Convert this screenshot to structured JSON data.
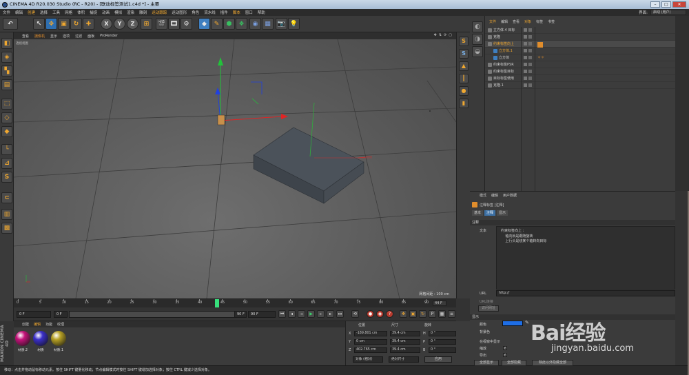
{
  "window": {
    "title": "CINEMA 4D R20.030 Studio (RC - R20) - [联动标签测试1.c4d *] - 主要",
    "min": "–",
    "max": "□",
    "close": "✕"
  },
  "menubar": {
    "items": [
      "文件",
      "编辑",
      "创建",
      "选择",
      "工具",
      "网格",
      "体积",
      "捕捉",
      "动画",
      "模拟",
      "渲染",
      "雕刻",
      "运动跟踪",
      "运动图形",
      "角色",
      "流水线",
      "插件",
      "脚本",
      "窗口",
      "帮助"
    ],
    "highlighted": [
      2,
      12,
      17
    ],
    "layout_label": "界面:",
    "layout_value": "启动 (用户)"
  },
  "toolbar": {
    "undo": "↶",
    "axes": [
      "X",
      "Y",
      "Z"
    ],
    "icons": [
      "live-select-icon",
      "move-icon",
      "scale-icon",
      "rotate-icon",
      "recent-tool-icon",
      "coordinate-system-icon",
      "render-view-icon",
      "render-picture-viewer-icon",
      "edit-render-settings-icon",
      "cube-icon",
      "pen-icon",
      "subdivision-icon",
      "array-icon",
      "deformer-icon",
      "floor-icon",
      "camera-icon",
      "light-icon"
    ]
  },
  "viewport": {
    "menu": [
      "查看",
      "摄像机",
      "显示",
      "选项",
      "过滤",
      "面板",
      "ProRender"
    ],
    "camera_label": "透视视图",
    "grid_label": "网格间距 : 100 cm"
  },
  "timeline": {
    "ticks": [
      0,
      5,
      10,
      15,
      20,
      25,
      30,
      35,
      40,
      45,
      50,
      55,
      60,
      65,
      70,
      75,
      80,
      85,
      90
    ],
    "current": 44,
    "current_label": "44 F"
  },
  "transport": {
    "start": "0 F",
    "min": "0 F",
    "max": "90 F",
    "end": "90 F"
  },
  "materials": {
    "menu": [
      "创建",
      "编辑",
      "功能",
      "纹理"
    ],
    "items": [
      {
        "name": "材质.2",
        "color": "#c4127a"
      },
      {
        "name": "材质",
        "color": "#3a2fc8"
      },
      {
        "name": "材质.1",
        "color": "#b6a024"
      }
    ],
    "brand": "MAXON CINEMA 4D"
  },
  "coords": {
    "headers": [
      "位置",
      "尺寸",
      "旋转"
    ],
    "rows": [
      {
        "axis": "X",
        "pos": "-189.801 cm",
        "size": "39.4 cm",
        "rot_axis": "H",
        "rot": "0 °"
      },
      {
        "axis": "Y",
        "pos": "0 cm",
        "size": "39.4 cm",
        "rot_axis": "P",
        "rot": "0 °"
      },
      {
        "axis": "Z",
        "pos": "402.765 cm",
        "size": "39.4 cm",
        "rot_axis": "B",
        "rot": "0 °"
      }
    ],
    "mode": "对象 (相对)",
    "size_mode": "绝对尺寸",
    "apply": "应用"
  },
  "object_manager": {
    "menu": [
      "文件",
      "编辑",
      "查看",
      "对象",
      "标签",
      "书签"
    ],
    "highlighted": [
      0,
      3
    ],
    "objects": [
      {
        "name": "立方体.4 目标",
        "indent": 0
      },
      {
        "name": "克隆",
        "indent": 0
      },
      {
        "name": "约束标签向上",
        "indent": 0,
        "selected": true,
        "highlight": true
      },
      {
        "name": "立方体.1",
        "indent": 1,
        "highlight": true
      },
      {
        "name": "立方体",
        "indent": 1
      },
      {
        "name": "约束标签PSR",
        "indent": 0
      },
      {
        "name": "约束标签目标",
        "indent": 0
      },
      {
        "name": "目标标签使用",
        "indent": 0
      },
      {
        "name": "克隆.1",
        "indent": 0
      }
    ]
  },
  "attributes": {
    "menu": [
      "模式",
      "编辑",
      "用户数据"
    ],
    "title": "注释标签 [注释]",
    "tabs": [
      "基本",
      "注释",
      "显示"
    ],
    "active_tab": 1,
    "section_note": "注释",
    "text_label": "文本",
    "text_lines": [
      "约束标签向上 :",
      "    轴向就是跟随旋转",
      "    上行头是绕某个轴转向目标"
    ],
    "url_label": "URL",
    "url_value": "http://",
    "url_btn": "URL链接",
    "open_btn": "访问网址",
    "section_display": "显示",
    "color_label": "颜色",
    "bg_color_label": "背景色",
    "show_in_viewport": "在视窗中显示",
    "scale_label": "缩放",
    "export_label": "导出",
    "btn_show_all": "全部显示",
    "btn_hide_all": "全部隐藏",
    "btn_show_except": "除此以外隐藏全部"
  },
  "status": {
    "text": "移动：点击并拖动鼠标移动元素。按住 SHIFT 键量化移动；节点编辑模式时按住 SHIFT 键增加选择对象；按住 CTRL 键减少选择对象。"
  },
  "watermark": {
    "brand": "Bai经验",
    "url": "jingyan.baidu.com"
  }
}
